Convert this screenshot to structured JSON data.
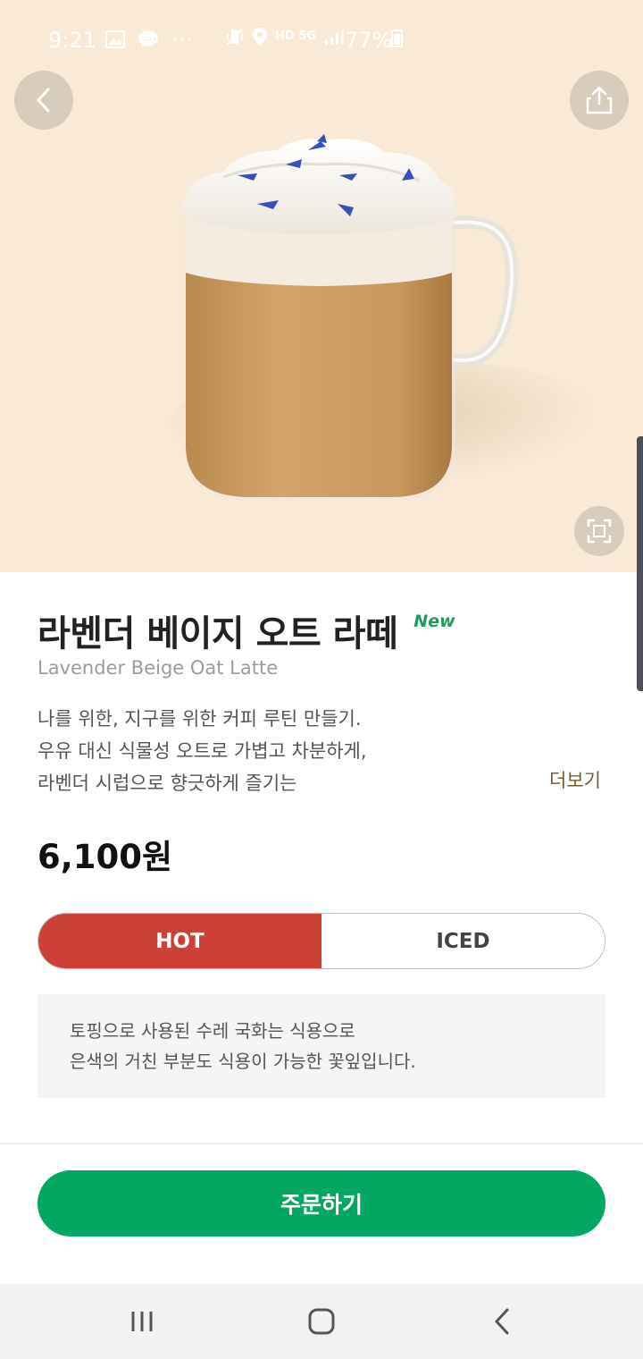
{
  "statusbar": {
    "time": "9:21",
    "network": "HD 5G",
    "battery": "77%"
  },
  "product": {
    "name_ko": "라벤더 베이지 오트 라떼",
    "badge": "New",
    "name_en": "Lavender Beige Oat Latte",
    "description": [
      "나를 위한, 지구를 위한 커피 루틴 만들기.",
      "우유 대신 식물성 오트로 가볍고 차분하게,",
      "라벤더 시럽으로 향긋하게 즐기는"
    ],
    "more_label": "더보기",
    "price": "6,100원"
  },
  "temperature": {
    "options": [
      "HOT",
      "ICED"
    ],
    "selected": "HOT"
  },
  "note": [
    "토핑으로 사용된 수레 국화는 식용으로",
    "은색의 거친 부분도 식용이 가능한 꽃잎입니다."
  ],
  "order_button": "주문하기",
  "colors": {
    "hero_bg": "#f8ead6",
    "hot": "#cd4036",
    "order": "#00a862",
    "new_badge": "#1f9c5a"
  }
}
